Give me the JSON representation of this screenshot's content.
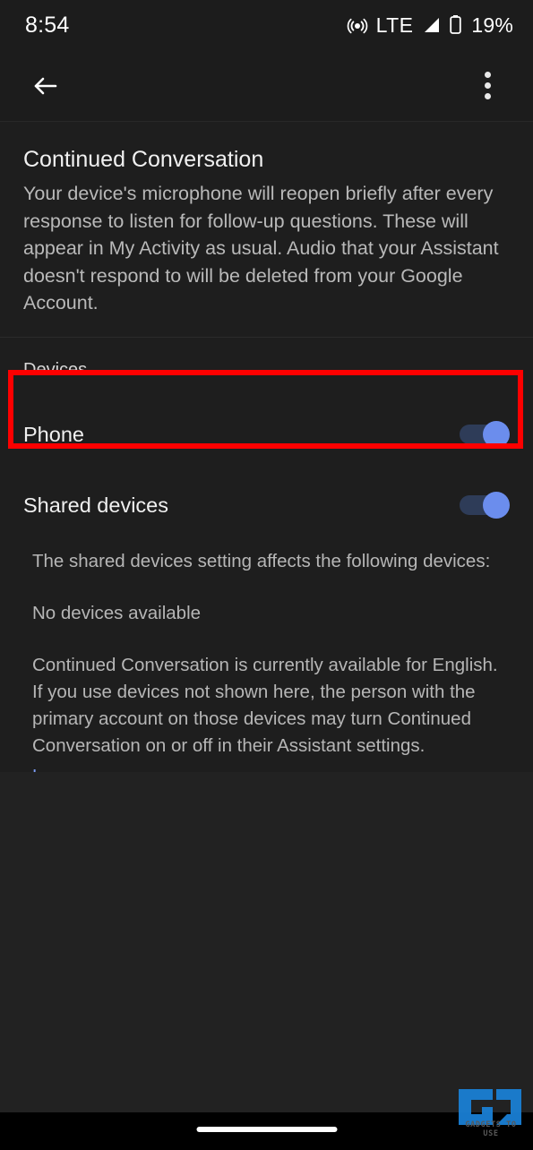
{
  "status_bar": {
    "time": "8:54",
    "network_label": "LTE",
    "battery_percent": "19%",
    "icons": [
      "hotspot-icon",
      "signal-icon",
      "battery-icon"
    ]
  },
  "app_bar": {
    "back_icon": "back-arrow-icon",
    "overflow_icon": "more-vertical-icon"
  },
  "intro": {
    "title": "Continued Conversation",
    "body": "Your device's microphone will reopen briefly after every response to listen for follow-up questions. These will appear in My Activity as usual. Audio that your Assistant doesn't respond to will be deleted from your Google Account."
  },
  "devices_section": {
    "label": "Devices",
    "rows": [
      {
        "label": "Phone",
        "toggle_state": "on",
        "highlighted": true
      },
      {
        "label": "Shared devices",
        "toggle_state": "on",
        "highlighted": false
      }
    ]
  },
  "shared_devices_info": {
    "affects_line": "The shared devices setting affects the following devices:",
    "no_devices_line": "No devices available",
    "availability_paragraph": "Continued Conversation is currently available for English. If you use devices not shown here, the person with the primary account on those devices may turn Continued Conversation on or off in their Assistant settings.",
    "learn_more_label": "Learn more"
  },
  "watermark": {
    "logo_label": "GU",
    "text": "GADGETS TO USE",
    "color": "#1a7fd4"
  },
  "colors": {
    "accent_toggle_thumb": "#6b8ded",
    "accent_toggle_track": "#2e3c58",
    "highlight_box": "#fe0000",
    "link": "#7b9bf2",
    "card_background": "#1e1e1e",
    "page_background": "#222222"
  },
  "nav_bar": {
    "gesture_pill": "home-gesture-pill"
  }
}
